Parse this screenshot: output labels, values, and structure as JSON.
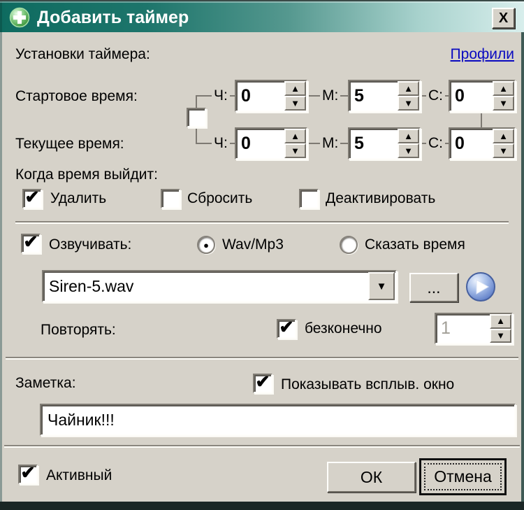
{
  "window": {
    "title": "Добавить таймер",
    "close_glyph": "X"
  },
  "header": {
    "settings_label": "Установки таймера:",
    "profiles_link": "Профили"
  },
  "time": {
    "start_label": "Стартовое время:",
    "current_label": "Текущее время:",
    "h_label": "Ч:",
    "m_label": "М:",
    "s_label": "С:",
    "start": {
      "h": "0",
      "m": "5",
      "s": "0"
    },
    "current": {
      "h": "0",
      "m": "5",
      "s": "0"
    },
    "link_mark": ""
  },
  "expire": {
    "label": "Когда время выйдит:",
    "options": [
      {
        "label": "Удалить",
        "mark": "✔"
      },
      {
        "label": "Сбросить",
        "mark": ""
      },
      {
        "label": "Деактивировать",
        "mark": ""
      }
    ]
  },
  "sound": {
    "enable_label": "Озвучивать:",
    "enable_mark": "✔",
    "wav_label": "Wav/Mp3",
    "wav_dot": "●",
    "say_label": "Сказать время",
    "say_dot": "",
    "file": "Siren-5.wav",
    "dropdown_glyph": "▼",
    "browse_label": "...",
    "repeat_label": "Повторять:",
    "infinite_label": "безконечно",
    "infinite_mark": "✔",
    "repeat_count": "1"
  },
  "note": {
    "label": "Заметка:",
    "popup_label": "Показывать всплыв. окно",
    "popup_mark": "✔",
    "text": "Чайник!!!"
  },
  "footer": {
    "active_label": "Активный",
    "active_mark": "✔",
    "ok_label": "ОК",
    "cancel_label": "Отмена"
  },
  "icons": {
    "up": "▲",
    "down": "▼"
  },
  "colors": {
    "titlebar_left": "#0e6b60",
    "titlebar_right": "#d8eeec",
    "dialog_bg": "#d6d2c9",
    "link": "#0a0ac0"
  }
}
